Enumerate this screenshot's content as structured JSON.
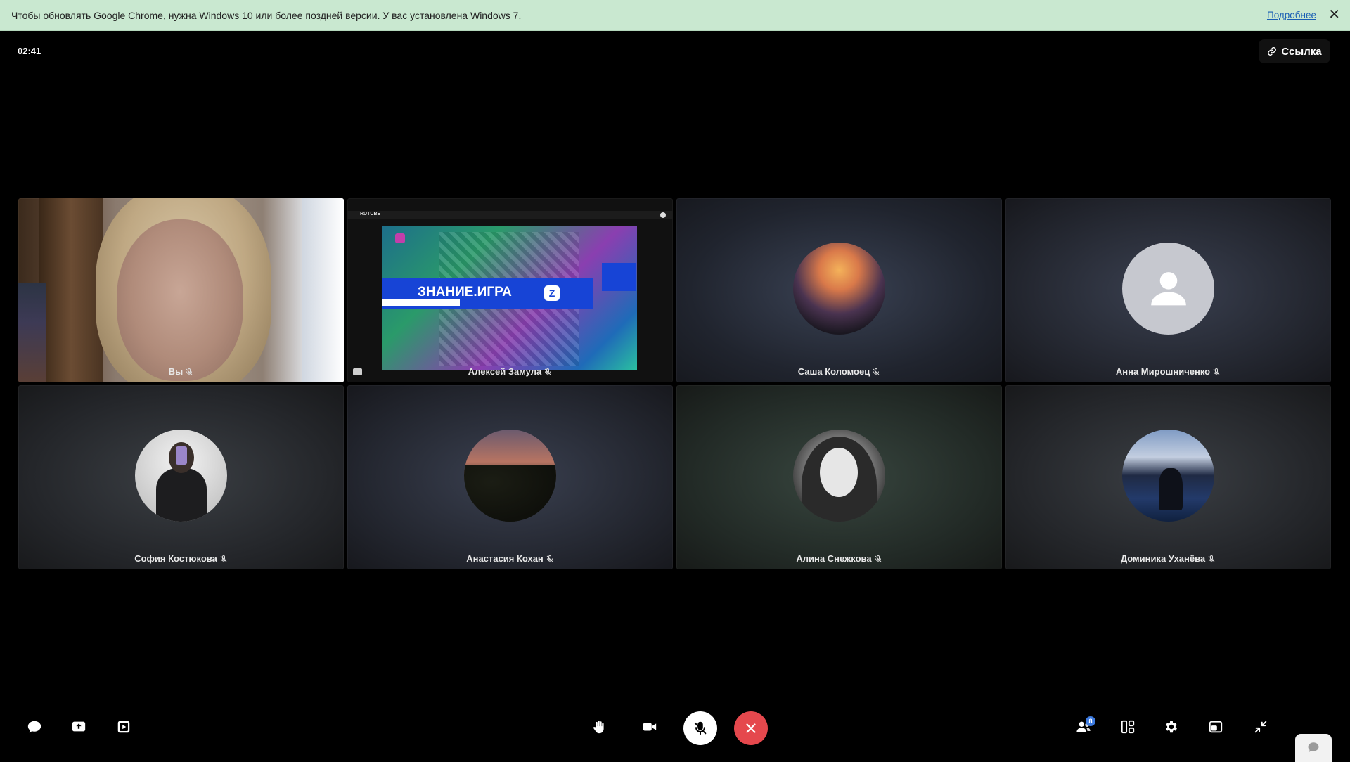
{
  "infobar": {
    "message": "Чтобы обновлять Google Chrome, нужна Windows 10 или более поздней версии. У вас установлена Windows 7.",
    "more_link": "Подробнее",
    "close_glyph": "✕"
  },
  "call": {
    "timer": "02:41",
    "link_button": "Ссылка"
  },
  "participants": [
    {
      "name": "Вы",
      "type": "camera",
      "muted": true
    },
    {
      "name": "Алексей Замула",
      "type": "screen-share",
      "muted": true,
      "share": {
        "brand": "RUTUBE",
        "title": "ЗНАНИЕ.ИГРА",
        "badge": "Z"
      }
    },
    {
      "name": "Саша Коломоец",
      "type": "avatar",
      "muted": true
    },
    {
      "name": "Анна Мирошниченко",
      "type": "placeholder-avatar",
      "muted": true
    },
    {
      "name": "София Костюкова",
      "type": "avatar",
      "muted": true
    },
    {
      "name": "Анастасия Кохан",
      "type": "avatar",
      "muted": true
    },
    {
      "name": "Алина Снежкова",
      "type": "avatar",
      "muted": true
    },
    {
      "name": "Доминика Уханёва",
      "type": "avatar",
      "muted": true
    }
  ],
  "toolbar": {
    "left": [
      "chat-icon",
      "share-screen-icon",
      "share-video-icon"
    ],
    "center": [
      "raise-hand-icon",
      "camera-icon",
      "microphone-muted-icon",
      "end-call-icon"
    ],
    "right": [
      "participants-icon",
      "layout-icon",
      "settings-icon",
      "picture-in-picture-icon",
      "exit-fullscreen-icon"
    ],
    "participants_count": "8"
  },
  "colors": {
    "infobar_bg": "#c9e8d0",
    "end_call": "#e5484d",
    "mic_button": "#ffffff",
    "badge": "#3d7be0"
  }
}
